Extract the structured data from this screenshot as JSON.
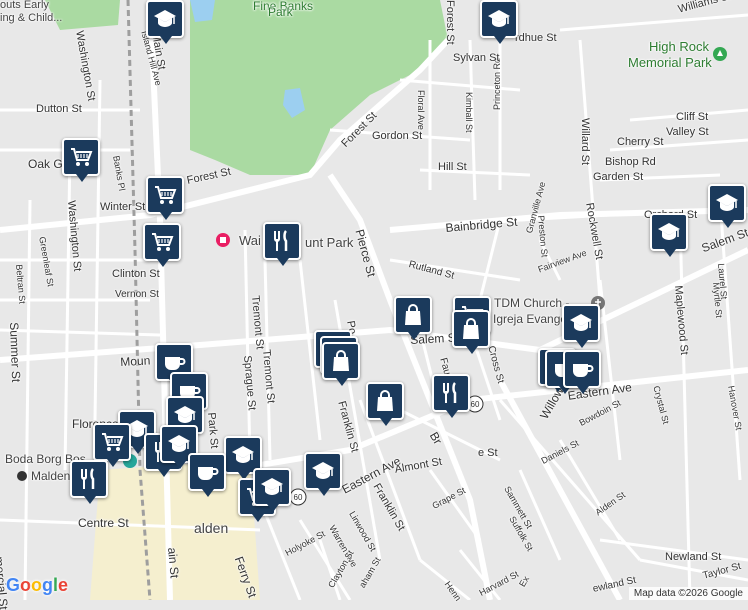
{
  "map_colors": {
    "background": "#e8e8e8",
    "road": "#ffffff",
    "park": "#aadaa2",
    "water": "#9ccff0",
    "highway": "#f7d774",
    "pin": "#1b3a5c"
  },
  "labels": [
    {
      "id": "l01",
      "text": "outs Early",
      "cls": "biz"
    },
    {
      "id": "l02",
      "text": "ing & Child...",
      "cls": "biz"
    },
    {
      "id": "l03",
      "text": "Fine Banks",
      "cls": "park"
    },
    {
      "id": "l04",
      "text": "Park",
      "cls": "park"
    },
    {
      "id": "l05",
      "text": "Main St",
      "cls": ""
    },
    {
      "id": "l06",
      "text": "Island Hill Ave",
      "cls": ""
    },
    {
      "id": "l07",
      "text": "Washington St",
      "cls": ""
    },
    {
      "id": "l08",
      "text": "Dutton St",
      "cls": ""
    },
    {
      "id": "l09",
      "text": "Oak G",
      "cls": ""
    },
    {
      "id": "l10",
      "text": "Banks Pl",
      "cls": ""
    },
    {
      "id": "l11",
      "text": "Winter St",
      "cls": ""
    },
    {
      "id": "l12",
      "text": "Forest St",
      "cls": ""
    },
    {
      "id": "l13",
      "text": "Forest St",
      "cls": ""
    },
    {
      "id": "l14",
      "text": "Forest St",
      "cls": ""
    },
    {
      "id": "l15",
      "text": "Floral Ave",
      "cls": ""
    },
    {
      "id": "l16",
      "text": "Gordon St",
      "cls": ""
    },
    {
      "id": "l17",
      "text": "Kimball St",
      "cls": ""
    },
    {
      "id": "l18",
      "text": "Princeton Rd",
      "cls": ""
    },
    {
      "id": "l19",
      "text": "Hill St",
      "cls": ""
    },
    {
      "id": "l20",
      "text": "Sylvan St",
      "cls": ""
    },
    {
      "id": "l21",
      "text": "rdhue St",
      "cls": ""
    },
    {
      "id": "l22",
      "text": "Williams St",
      "cls": ""
    },
    {
      "id": "l23",
      "text": "High Rock",
      "cls": "park"
    },
    {
      "id": "l24",
      "text": "Memorial Park",
      "cls": "park"
    },
    {
      "id": "l25",
      "text": "Willard St",
      "cls": ""
    },
    {
      "id": "l26",
      "text": "Cliff St",
      "cls": ""
    },
    {
      "id": "l27",
      "text": "Valley St",
      "cls": ""
    },
    {
      "id": "l28",
      "text": "Cherry St",
      "cls": ""
    },
    {
      "id": "l29",
      "text": "Bishop Rd",
      "cls": ""
    },
    {
      "id": "l30",
      "text": "Garden St",
      "cls": ""
    },
    {
      "id": "l31",
      "text": "Bainbridge St",
      "cls": ""
    },
    {
      "id": "l32",
      "text": "Rockwell St",
      "cls": ""
    },
    {
      "id": "l33",
      "text": "Orchard St",
      "cls": ""
    },
    {
      "id": "l34",
      "text": "Preston St",
      "cls": ""
    },
    {
      "id": "l35",
      "text": "Granville Ave",
      "cls": ""
    },
    {
      "id": "l36",
      "text": "Fairview Ave",
      "cls": ""
    },
    {
      "id": "l37",
      "text": "Salem St",
      "cls": ""
    },
    {
      "id": "l38",
      "text": "Maplewood St",
      "cls": ""
    },
    {
      "id": "l39",
      "text": "Myrtle St",
      "cls": ""
    },
    {
      "id": "l40",
      "text": "Laurel St",
      "cls": ""
    },
    {
      "id": "l41",
      "text": "Rutland St",
      "cls": ""
    },
    {
      "id": "l42",
      "text": "Pierce St",
      "cls": ""
    },
    {
      "id": "l43",
      "text": "Wai",
      "cls": "biz"
    },
    {
      "id": "l44",
      "text": "unt Park",
      "cls": "biz"
    },
    {
      "id": "l45",
      "text": "Clinton St",
      "cls": ""
    },
    {
      "id": "l46",
      "text": "Vernon St",
      "cls": ""
    },
    {
      "id": "l47",
      "text": "Greenleaf St",
      "cls": ""
    },
    {
      "id": "l48",
      "text": "Beltran St",
      "cls": ""
    },
    {
      "id": "l49",
      "text": "Washington St",
      "cls": ""
    },
    {
      "id": "l50",
      "text": "Summer St",
      "cls": ""
    },
    {
      "id": "l51",
      "text": "Moun",
      "cls": ""
    },
    {
      "id": "l52",
      "text": "Tremont St",
      "cls": ""
    },
    {
      "id": "l53",
      "text": "Tremont St",
      "cls": ""
    },
    {
      "id": "l54",
      "text": "Sprague St",
      "cls": ""
    },
    {
      "id": "l55",
      "text": "TDM Church -",
      "cls": "biz"
    },
    {
      "id": "l56",
      "text": "Igreja Evange",
      "cls": "biz"
    },
    {
      "id": "l57",
      "text": "Salem St",
      "cls": ""
    },
    {
      "id": "l58",
      "text": "Faulk",
      "cls": ""
    },
    {
      "id": "l59",
      "text": "Cross St",
      "cls": ""
    },
    {
      "id": "l60",
      "text": "Eastern Ave",
      "cls": ""
    },
    {
      "id": "l61",
      "text": "Crystal St",
      "cls": ""
    },
    {
      "id": "l62",
      "text": "Hanover St",
      "cls": ""
    },
    {
      "id": "l63",
      "text": "Florence",
      "cls": ""
    },
    {
      "id": "l64",
      "text": "Boda Borg Bos",
      "cls": "biz"
    },
    {
      "id": "l65",
      "text": "Malden",
      "cls": "biz"
    },
    {
      "id": "l66",
      "text": "Park St",
      "cls": ""
    },
    {
      "id": "l67",
      "text": "Franklin St",
      "cls": ""
    },
    {
      "id": "l68",
      "text": "Franklin St",
      "cls": ""
    },
    {
      "id": "l69",
      "text": "Eastern Ave",
      "cls": ""
    },
    {
      "id": "l70",
      "text": "Almont St",
      "cls": ""
    },
    {
      "id": "l71",
      "text": "Br",
      "cls": ""
    },
    {
      "id": "l72",
      "text": "Willow",
      "cls": ""
    },
    {
      "id": "l73",
      "text": "Bowdoin St",
      "cls": ""
    },
    {
      "id": "l74",
      "text": "Daniels St",
      "cls": ""
    },
    {
      "id": "l75",
      "text": "Alden St",
      "cls": ""
    },
    {
      "id": "l76",
      "text": "Sammett St",
      "cls": ""
    },
    {
      "id": "l77",
      "text": "Suffolk St",
      "cls": ""
    },
    {
      "id": "l78",
      "text": "Grape St",
      "cls": ""
    },
    {
      "id": "l79",
      "text": "Newland St",
      "cls": ""
    },
    {
      "id": "l80",
      "text": "Taylor St",
      "cls": ""
    },
    {
      "id": "l81",
      "text": "Linwood St",
      "cls": ""
    },
    {
      "id": "l82",
      "text": "Warren Ave",
      "cls": ""
    },
    {
      "id": "l83",
      "text": "Centre St",
      "cls": ""
    },
    {
      "id": "l84",
      "text": "alden",
      "cls": "biz"
    },
    {
      "id": "l85",
      "text": "Holyoke St",
      "cls": ""
    },
    {
      "id": "l86",
      "text": "Clayton St",
      "cls": ""
    },
    {
      "id": "l87",
      "text": "Ferry St",
      "cls": ""
    },
    {
      "id": "l88",
      "text": "Harvard St",
      "cls": ""
    },
    {
      "id": "l89",
      "text": "Henn",
      "cls": ""
    },
    {
      "id": "l90",
      "text": "Ex",
      "cls": ""
    },
    {
      "id": "l91",
      "text": "ewland St",
      "cls": ""
    },
    {
      "id": "l92",
      "text": "mercial St",
      "cls": ""
    },
    {
      "id": "l93",
      "text": "ain St",
      "cls": ""
    },
    {
      "id": "l94",
      "text": "Po",
      "cls": ""
    },
    {
      "id": "l95",
      "text": "e St",
      "cls": ""
    },
    {
      "id": "l96",
      "text": "aham St",
      "cls": ""
    }
  ],
  "route_shields": [
    "60",
    "60",
    "60"
  ],
  "markers": [
    {
      "type": "school",
      "icon_name": "school-icon"
    },
    {
      "type": "school",
      "icon_name": "school-icon"
    },
    {
      "type": "school",
      "icon_name": "school-icon"
    },
    {
      "type": "grocery",
      "icon_name": "cart-icon"
    },
    {
      "type": "grocery",
      "icon_name": "cart-icon"
    },
    {
      "type": "grocery",
      "icon_name": "cart-icon"
    },
    {
      "type": "restaurant",
      "icon_name": "fork-knife-icon"
    },
    {
      "type": "school",
      "icon_name": "school-icon"
    },
    {
      "type": "shopping",
      "icon_name": "bag-icon"
    },
    {
      "type": "grocery",
      "icon_name": "cart-icon"
    },
    {
      "type": "shopping",
      "icon_name": "bag-icon"
    },
    {
      "type": "school",
      "icon_name": "school-icon"
    },
    {
      "type": "shopping",
      "icon_name": "bag-icon"
    },
    {
      "type": "shopping",
      "icon_name": "bag-icon"
    },
    {
      "type": "shopping",
      "icon_name": "bag-icon"
    },
    {
      "type": "shopping",
      "icon_name": "bag-icon"
    },
    {
      "type": "restaurant",
      "icon_name": "fork-knife-icon"
    },
    {
      "type": "cafe",
      "icon_name": "coffee-cup-icon"
    },
    {
      "type": "cafe",
      "icon_name": "coffee-cup-icon"
    },
    {
      "type": "cafe",
      "icon_name": "coffee-cup-icon"
    },
    {
      "type": "cafe",
      "icon_name": "coffee-cup-icon"
    },
    {
      "type": "cafe",
      "icon_name": "coffee-cup-icon"
    },
    {
      "type": "school",
      "icon_name": "school-icon"
    },
    {
      "type": "school",
      "icon_name": "school-icon"
    },
    {
      "type": "grocery",
      "icon_name": "cart-icon"
    },
    {
      "type": "restaurant",
      "icon_name": "fork-knife-icon"
    },
    {
      "type": "restaurant",
      "icon_name": "fork-knife-icon"
    },
    {
      "type": "school",
      "icon_name": "school-icon"
    },
    {
      "type": "school",
      "icon_name": "school-icon"
    },
    {
      "type": "cafe",
      "icon_name": "coffee-cup-icon"
    },
    {
      "type": "grocery",
      "icon_name": "cart-icon"
    },
    {
      "type": "school",
      "icon_name": "school-icon"
    },
    {
      "type": "school",
      "icon_name": "school-icon"
    }
  ],
  "google_logo": "Google",
  "attribution": "Map data ©2026 Google"
}
